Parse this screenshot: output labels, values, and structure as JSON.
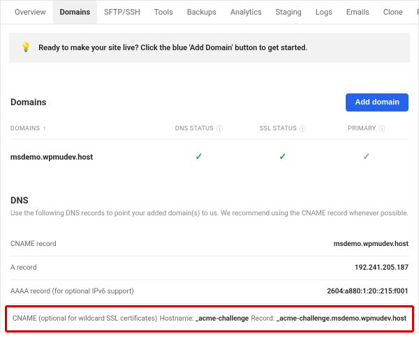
{
  "tabs": {
    "items": [
      "Overview",
      "Domains",
      "SFTP/SSH",
      "Tools",
      "Backups",
      "Analytics",
      "Staging",
      "Logs",
      "Emails"
    ],
    "right": [
      "Clone",
      "Pricing"
    ],
    "active": "Domains"
  },
  "banner": {
    "text": "Ready to make your site live? Click the blue 'Add Domain' button to get started."
  },
  "domains": {
    "title": "Domains",
    "add_label": "Add domain",
    "columns": {
      "domain": "DOMAINS",
      "dns": "DNS STATUS",
      "ssl": "SSL STATUS",
      "primary": "PRIMARY"
    },
    "rows": [
      {
        "domain": "msdemo.wpmudev.host",
        "dns": "ok",
        "ssl": "ok",
        "primary": "ok"
      }
    ]
  },
  "dns": {
    "title": "DNS",
    "desc": "Use the following DNS records to point your added domain(s) to us. We recommend using the CNAME record whenever possible.",
    "records": {
      "cname": {
        "label": "CNAME record",
        "value": "msdemo.wpmudev.host"
      },
      "a": {
        "label": "A record",
        "value": "192.241.205.187"
      },
      "aaaa": {
        "label": "AAAA record (for optional IPv6 support)",
        "value": "2604:a880:1:20::215:f001"
      },
      "wildcard": {
        "label": "CNAME (optional for wildcard SSL certificates)",
        "hostname_label": "Hostname:",
        "hostname": "_acme-challenge",
        "record_label": "Record:",
        "record": "_acme-challenge.msdemo.wpmudev.host"
      }
    }
  }
}
